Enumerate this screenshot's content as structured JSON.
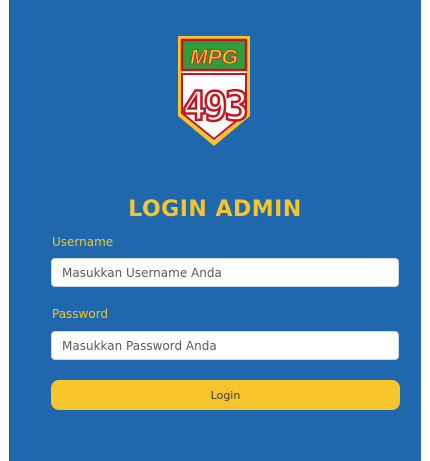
{
  "logo": {
    "top_text": "MPG",
    "bottom_text": "493",
    "colors": {
      "border": "#f5c52b",
      "top_band": "#2e9e3a",
      "top_text": "#f5c52b",
      "bottom_fill": "#ffffff",
      "bottom_text": "#d42a2a",
      "outline": "#c8141e"
    }
  },
  "title": "LOGIN ADMIN",
  "username": {
    "label": "Username",
    "placeholder": "Masukkan Username Anda",
    "value": ""
  },
  "password": {
    "label": "Password",
    "placeholder": "Masukkan Password Anda",
    "value": ""
  },
  "login_button": "Login",
  "colors": {
    "background": "#2068ad",
    "accent": "#f5c52b"
  }
}
